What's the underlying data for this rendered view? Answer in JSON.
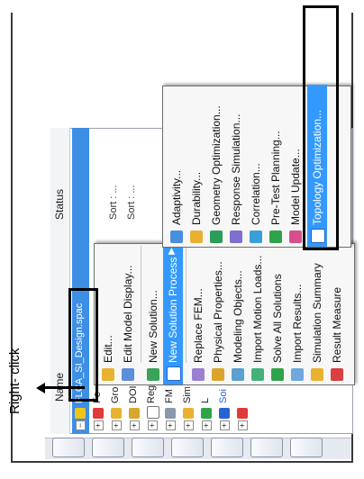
{
  "annotation": {
    "label": "Right- click"
  },
  "navigator": {
    "col_name": "Name",
    "col_status": "Status",
    "sort_label": "Sort : ...",
    "rows": [
      {
        "label": "FLCA_SI_Design.spac",
        "selected": true
      },
      {
        "label": "Fe",
        "selected": false
      },
      {
        "label": "Gro",
        "selected": false
      },
      {
        "label": "DOI",
        "selected": false
      },
      {
        "label": "Reg",
        "selected": false
      },
      {
        "label": "FM F",
        "selected": false
      },
      {
        "label": "Sim",
        "selected": false
      },
      {
        "label": "L",
        "selected": false
      },
      {
        "label": "Soi",
        "selected": false
      },
      {
        "label": "",
        "selected": false
      }
    ]
  },
  "context_menu": {
    "items": [
      {
        "label": "Edit...",
        "icon": "edit-icon"
      },
      {
        "label": "Edit Model Display...",
        "icon": "display-icon"
      },
      {
        "label": "New Solution...",
        "icon": "new-solution-icon"
      },
      {
        "label": "New Solution Process",
        "icon": "solution-process-icon",
        "submenu_arrow": "▶"
      },
      {
        "label": "Replace FEM...",
        "icon": "replace-icon"
      },
      {
        "label": "Physical Properties...",
        "icon": "physical-icon"
      },
      {
        "label": "Modeling Objects...",
        "icon": "modeling-icon"
      },
      {
        "label": "Import Motion Loads...",
        "icon": "motion-icon"
      },
      {
        "label": "Solve All Solutions",
        "icon": "solve-icon"
      },
      {
        "label": "Import Results...",
        "icon": "import-icon"
      },
      {
        "label": "Simulation Summary",
        "icon": "summary-icon"
      },
      {
        "label": "Result Measure",
        "icon": "measure-icon"
      }
    ]
  },
  "submenu": {
    "items": [
      {
        "label": "Adaptivity...",
        "icon": "adaptivity-icon"
      },
      {
        "label": "Durability...",
        "icon": "durability-icon"
      },
      {
        "label": "Geometry Optimization...",
        "icon": "geometry-icon"
      },
      {
        "label": "Response Simulation...",
        "icon": "response-icon"
      },
      {
        "label": "Correlation...",
        "icon": "correlation-icon"
      },
      {
        "label": "Pre-Test Planning...",
        "icon": "pretest-icon"
      },
      {
        "label": "Model Update...",
        "icon": "model-update-icon"
      },
      {
        "label": "Topology Optimization...",
        "icon": "topology-icon"
      }
    ]
  },
  "colors": {
    "highlight": "#3399ff",
    "selection": "#3d8ee5",
    "outline": "#000000"
  }
}
